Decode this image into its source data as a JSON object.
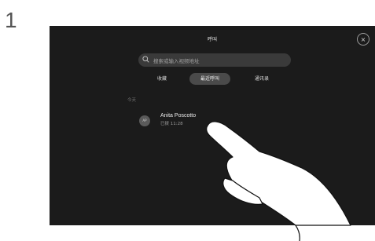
{
  "step_number": "1",
  "screen": {
    "title": "呼叫",
    "close_icon": "×",
    "search": {
      "placeholder": "搜索或输入视频地址"
    },
    "tabs": [
      {
        "label": "收藏",
        "active": false
      },
      {
        "label": "最近呼叫",
        "active": true
      },
      {
        "label": "通讯录",
        "active": false
      }
    ],
    "section_label": "今天",
    "recent_call": {
      "avatar_initials": "AP",
      "name": "Anita Poscotto",
      "detail": "已拨 11:28"
    }
  },
  "colors": {
    "screen_bg": "#1b1b1b",
    "active_tab": "#4a4a4a",
    "search_bg": "#3a3a3a"
  }
}
